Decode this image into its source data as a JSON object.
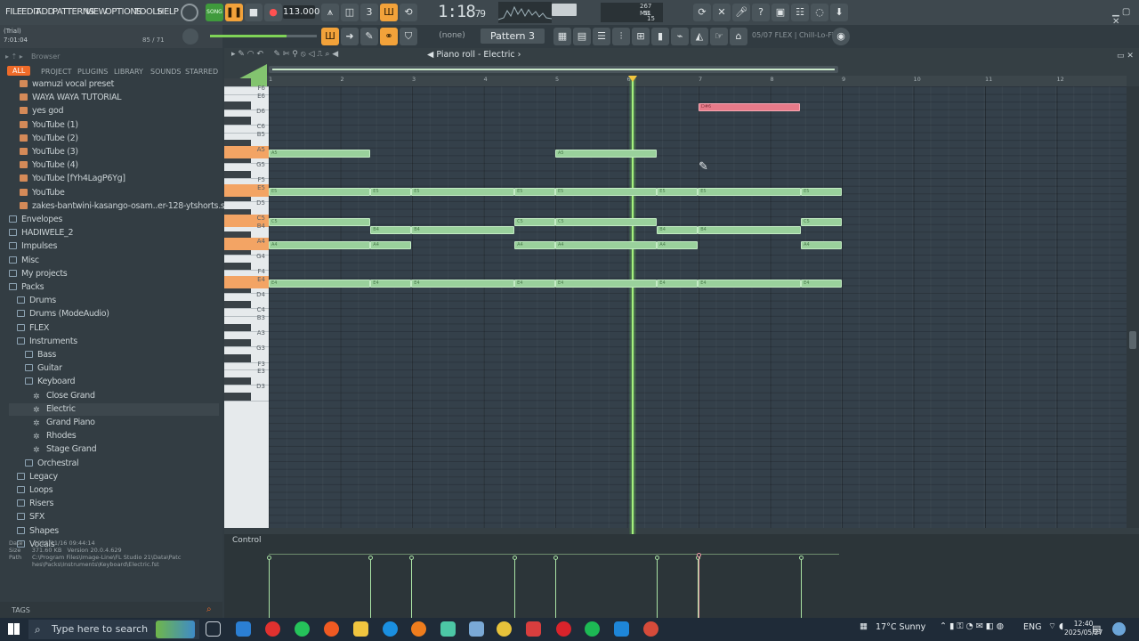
{
  "menu": [
    "FILE",
    "EDIT",
    "ADD",
    "PATTERNS",
    "VIEW",
    "OPTIONS",
    "TOOLS",
    "HELP"
  ],
  "hint": {
    "line1": "(Trial)",
    "line2": "7:01:04",
    "count": "85 / 71"
  },
  "transport": {
    "song_label": "SONG",
    "tempo": "113.000",
    "time": "1:18",
    "time_small": "79",
    "cpu_mem": "267 MB",
    "cpu_val": "51",
    "cpu_val2": "15"
  },
  "pattern": {
    "name": "Pattern 3",
    "none": "(none)",
    "flex": "05/07 FLEX | Chill-Lo-Fi-2"
  },
  "browser": {
    "title": "Browser",
    "tabs": [
      "ALL",
      "PROJECT",
      "PLUGINS",
      "LIBRARY",
      "SOUNDS",
      "STARRED"
    ],
    "items": [
      {
        "label": "wamuzi vocal preset",
        "type": "file",
        "indent": 1
      },
      {
        "label": "WAYA WAYA TUTORIAL",
        "type": "file",
        "indent": 1
      },
      {
        "label": "yes god",
        "type": "file",
        "indent": 1
      },
      {
        "label": "YouTube (1)",
        "type": "file",
        "indent": 1
      },
      {
        "label": "YouTube (2)",
        "type": "file",
        "indent": 1
      },
      {
        "label": "YouTube (3)",
        "type": "file",
        "indent": 1
      },
      {
        "label": "YouTube (4)",
        "type": "file",
        "indent": 1
      },
      {
        "label": "YouTube [fYh4LagP6Yg]",
        "type": "file",
        "indent": 1
      },
      {
        "label": "YouTube",
        "type": "file",
        "indent": 1
      },
      {
        "label": "zakes-bantwini-kasango-osam..er-128-ytshorts.savetube.me ★",
        "type": "file",
        "indent": 1
      },
      {
        "label": "Envelopes",
        "type": "fold",
        "indent": 0
      },
      {
        "label": "HADIWELE_2",
        "type": "fold",
        "indent": 0
      },
      {
        "label": "Impulses",
        "type": "fold",
        "indent": 0
      },
      {
        "label": "Misc",
        "type": "fold",
        "indent": 0
      },
      {
        "label": "My projects",
        "type": "fold",
        "indent": 0
      },
      {
        "label": "Packs",
        "type": "fold",
        "indent": 0
      },
      {
        "label": "Drums",
        "type": "fold",
        "indent": 1
      },
      {
        "label": "Drums (ModeAudio)",
        "type": "fold",
        "indent": 1
      },
      {
        "label": "FLEX",
        "type": "fold",
        "indent": 1
      },
      {
        "label": "Instruments",
        "type": "fold",
        "indent": 1
      },
      {
        "label": "Bass",
        "type": "fold",
        "indent": 2
      },
      {
        "label": "Guitar",
        "type": "fold",
        "indent": 2
      },
      {
        "label": "Keyboard",
        "type": "fold",
        "indent": 2
      },
      {
        "label": "Close Grand",
        "type": "gear",
        "indent": 3
      },
      {
        "label": "Electric",
        "type": "gear",
        "indent": 3,
        "selected": true
      },
      {
        "label": "Grand Piano",
        "type": "gear",
        "indent": 3
      },
      {
        "label": "Rhodes",
        "type": "gear",
        "indent": 3
      },
      {
        "label": "Stage Grand",
        "type": "gear",
        "indent": 3
      },
      {
        "label": "Orchestral",
        "type": "fold",
        "indent": 2
      },
      {
        "label": "Legacy",
        "type": "fold",
        "indent": 1
      },
      {
        "label": "Loops",
        "type": "fold",
        "indent": 1
      },
      {
        "label": "Risers",
        "type": "fold",
        "indent": 1
      },
      {
        "label": "SFX",
        "type": "fold",
        "indent": 1
      },
      {
        "label": "Shapes",
        "type": "fold",
        "indent": 1
      },
      {
        "label": "Vocals",
        "type": "fold",
        "indent": 1
      }
    ],
    "info": {
      "date_label": "Date",
      "date": "2022/11/16 09:44:14",
      "size_label": "Size",
      "size": "371.60 KB",
      "version_label": "Version",
      "version": "20.0.4.629",
      "path_label": "Path",
      "path": "C:\\Program Files\\Image-Line\\FL Studio 21\\Data\\Patches\\Packs\\Instruments\\Keyboard\\Electric.fst"
    },
    "tags_label": "TAGS"
  },
  "roll": {
    "title": "Piano roll - Electric",
    "ruler": [
      "1",
      "2",
      "3",
      "4",
      "5",
      "6",
      "7",
      "8",
      "9",
      "10",
      "11",
      "12"
    ],
    "keys": [
      "F6",
      "E6",
      "D6",
      "C6",
      "B5",
      "A5",
      "G5",
      "F5",
      "E5",
      "D5",
      "C5",
      "B4",
      "A4",
      "G4",
      "F4",
      "E4",
      "D4",
      "C4",
      "B3",
      "A3",
      "G3",
      "F3",
      "E3",
      "D3"
    ],
    "control_label": "Control",
    "notes": [
      {
        "pitch": "A5",
        "start": 0,
        "len": 1.42
      },
      {
        "pitch": "A5",
        "start": 4.0,
        "len": 1.42
      },
      {
        "pitch": "E5",
        "start": 0,
        "len": 1.42
      },
      {
        "pitch": "E5",
        "start": 1.42,
        "len": 0.57
      },
      {
        "pitch": "E5",
        "start": 1.99,
        "len": 1.44
      },
      {
        "pitch": "E5",
        "start": 3.43,
        "len": 0.57
      },
      {
        "pitch": "E5",
        "start": 4.0,
        "len": 1.42
      },
      {
        "pitch": "E5",
        "start": 5.42,
        "len": 0.57
      },
      {
        "pitch": "E5",
        "start": 5.99,
        "len": 1.44
      },
      {
        "pitch": "E5",
        "start": 7.43,
        "len": 0.57
      },
      {
        "pitch": "C5",
        "start": 0,
        "len": 1.42
      },
      {
        "pitch": "C5",
        "start": 3.43,
        "len": 0.57
      },
      {
        "pitch": "C5",
        "start": 4.0,
        "len": 1.42
      },
      {
        "pitch": "C5",
        "start": 7.43,
        "len": 0.57
      },
      {
        "pitch": "B4",
        "start": 1.42,
        "len": 0.57
      },
      {
        "pitch": "B4",
        "start": 1.99,
        "len": 1.44
      },
      {
        "pitch": "B4",
        "start": 5.42,
        "len": 0.57
      },
      {
        "pitch": "B4",
        "start": 5.99,
        "len": 1.44
      },
      {
        "pitch": "A4",
        "start": 0,
        "len": 1.42
      },
      {
        "pitch": "A4",
        "start": 1.42,
        "len": 0.57
      },
      {
        "pitch": "A4",
        "start": 3.43,
        "len": 0.57
      },
      {
        "pitch": "A4",
        "start": 4.0,
        "len": 1.42
      },
      {
        "pitch": "A4",
        "start": 5.42,
        "len": 0.57
      },
      {
        "pitch": "A4",
        "start": 7.43,
        "len": 0.57
      },
      {
        "pitch": "E4",
        "start": 0,
        "len": 1.42
      },
      {
        "pitch": "E4",
        "start": 1.42,
        "len": 0.57
      },
      {
        "pitch": "E4",
        "start": 1.99,
        "len": 1.44
      },
      {
        "pitch": "E4",
        "start": 3.43,
        "len": 0.57
      },
      {
        "pitch": "E4",
        "start": 4.0,
        "len": 1.42
      },
      {
        "pitch": "E4",
        "start": 5.42,
        "len": 0.57
      },
      {
        "pitch": "E4",
        "start": 5.99,
        "len": 1.44
      },
      {
        "pitch": "E4",
        "start": 7.43,
        "len": 0.57
      },
      {
        "pitch": "D#6",
        "start": 6.0,
        "len": 1.42,
        "color": "red"
      }
    ],
    "velocities": [
      0,
      1.42,
      1.99,
      3.43,
      4.0,
      5.42,
      5.99,
      7.43
    ],
    "red_velocity": 6.0,
    "playhead_bar": 5.08
  },
  "taskbar": {
    "search_placeholder": "Type here to search",
    "weather": "17°C  Sunny",
    "lang": "ENG",
    "time": "12:40",
    "date": "2025/05/27"
  },
  "colors": {
    "accent": "#ef6b29",
    "note": "#9ad19c",
    "note_red": "#e77a89",
    "playhead": "#a4ef7d"
  }
}
